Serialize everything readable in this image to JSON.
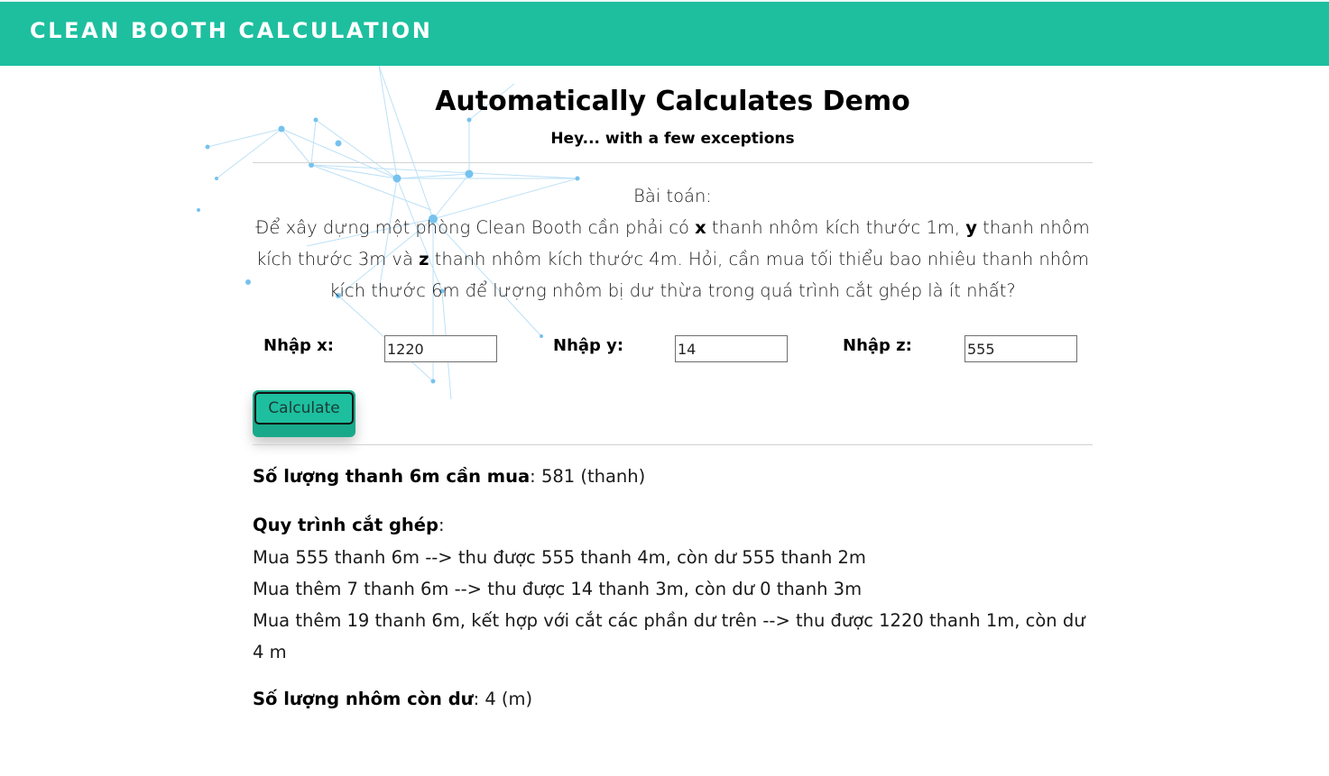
{
  "header": {
    "brand": "CLEAN BOOTH CALCULATION"
  },
  "main": {
    "title": "Automatically Calculates Demo",
    "subtitle": "Hey... with a few exceptions",
    "problem": {
      "heading": "Bài toán:",
      "part1": "Để xây dựng một phòng Clean Booth cần phải có ",
      "var_x": "x",
      "part2": " thanh nhôm kích thước 1m, ",
      "var_y": "y",
      "part3": " thanh nhôm kích thước 3m và ",
      "var_z": "z",
      "part4": " thanh nhôm kích thước 4m. Hỏi, cần mua tối thiểu bao nhiêu thanh nhôm kích thước 6m để lượng nhôm bị dư thừa trong quá trình cắt ghép là ít nhất?"
    },
    "inputs": {
      "x_label": "Nhập x:",
      "x_value": "1220",
      "y_label": "Nhập y:",
      "y_value": "14",
      "z_label": "Nhập z:",
      "z_value": "555"
    },
    "calculate_label": "Calculate",
    "results": {
      "count_label": "Số lượng thanh 6m cần mua",
      "count_value": ": 581 (thanh)",
      "process_label": "Quy trình cắt ghép",
      "process_colon": ":",
      "steps": [
        "Mua 555 thanh 6m --> thu được 555 thanh 4m, còn dư 555 thanh 2m",
        "Mua thêm 7 thanh 6m --> thu được 14 thanh 3m, còn dư 0 thanh 3m",
        "Mua thêm 19 thanh 6m, kết hợp với cắt các phần dư trên --> thu được 1220 thanh 1m, còn dư 4 m"
      ],
      "leftover_label": "Số lượng nhôm còn dư",
      "leftover_value": ": 4 (m)"
    }
  },
  "colors": {
    "brand": "#1dbf9f",
    "button_shadow": "#19a98a"
  }
}
